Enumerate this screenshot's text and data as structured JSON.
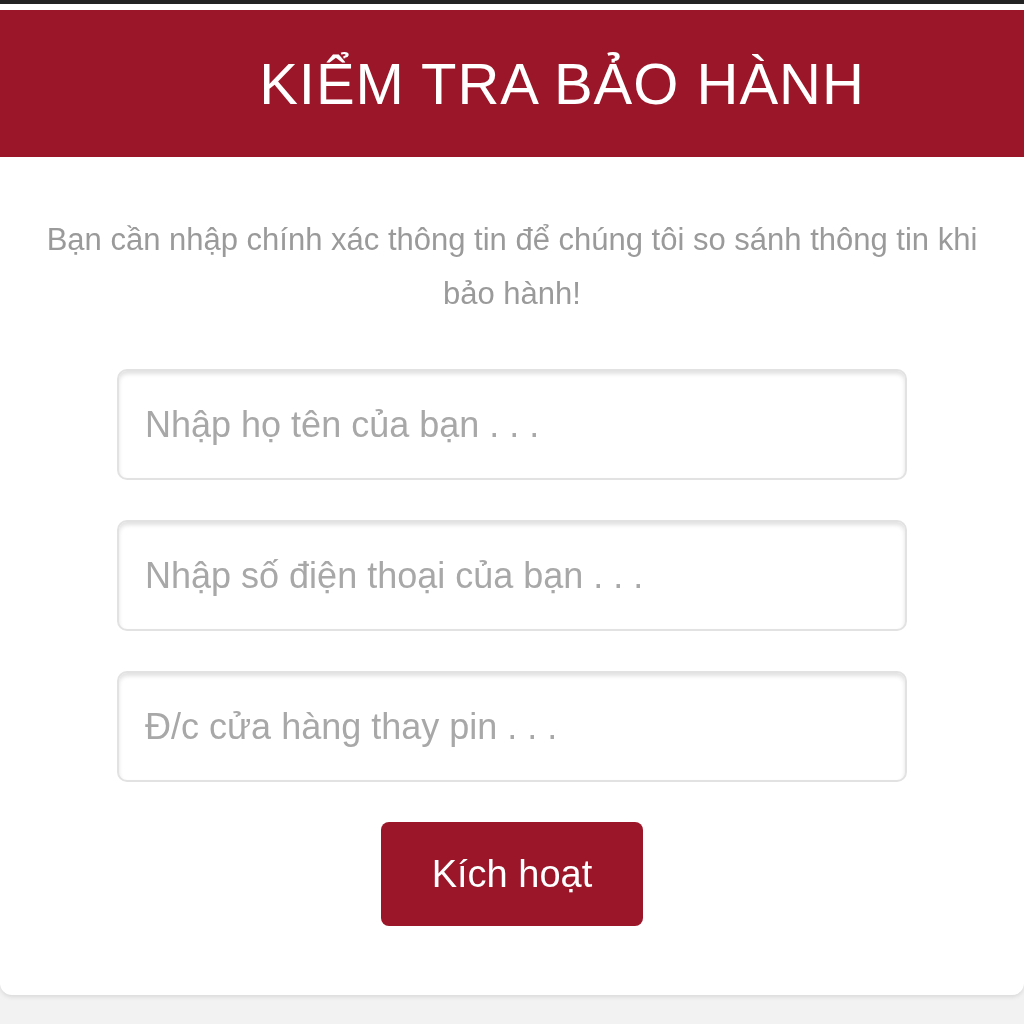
{
  "header": {
    "title": "KIỂM TRA BẢO HÀNH"
  },
  "intro": "Bạn cần nhập chính xác thông tin để chúng tôi so sánh thông tin khi bảo hành!",
  "fields": [
    {
      "placeholder": "Nhập họ tên của bạn . . ."
    },
    {
      "placeholder": "Nhập số điện thoại của bạn . . ."
    },
    {
      "placeholder": "Đ/c cửa hàng thay pin . . ."
    }
  ],
  "button": {
    "label": "Kích hoạt"
  }
}
